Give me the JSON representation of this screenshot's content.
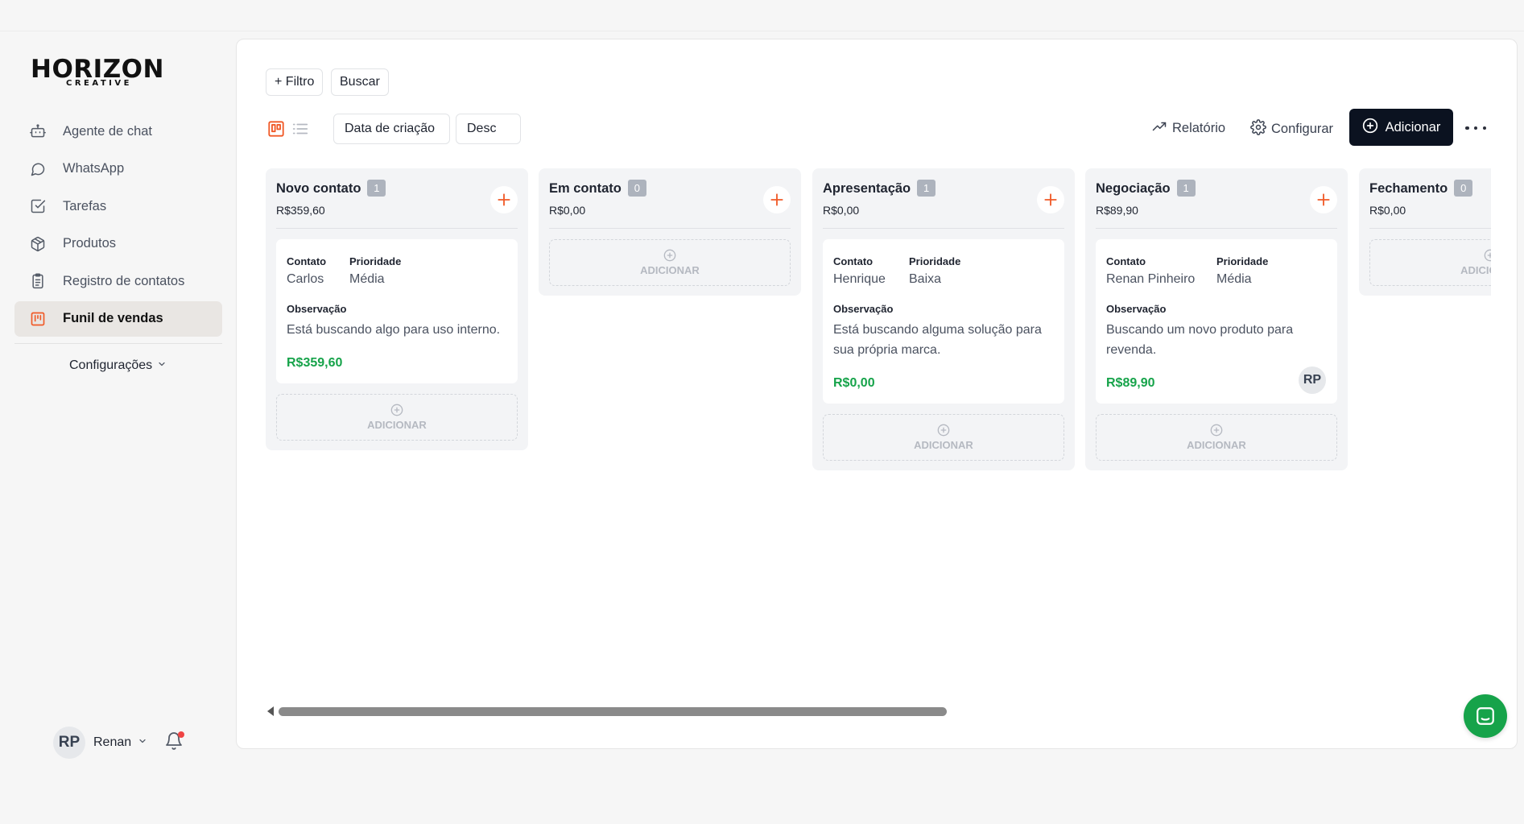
{
  "brand": {
    "name": "HORIZON",
    "tagline": "CREATIVE"
  },
  "sidebar": {
    "items": [
      {
        "label": "Agente de chat",
        "icon": "bot-icon"
      },
      {
        "label": "WhatsApp",
        "icon": "chat-bubble-icon"
      },
      {
        "label": "Tarefas",
        "icon": "checkbox-icon"
      },
      {
        "label": "Produtos",
        "icon": "package-icon"
      },
      {
        "label": "Registro de contatos",
        "icon": "clipboard-icon"
      },
      {
        "label": "Funil de vendas",
        "icon": "kanban-icon",
        "active": true
      }
    ],
    "settings_label": "Configurações",
    "user": {
      "initials": "RP",
      "name": "Renan",
      "has_notification": true
    }
  },
  "toolbar": {
    "filter_label": "+ Filtro",
    "search_label": "Buscar",
    "sort_field": "Data de criação",
    "sort_order": "Desc",
    "report_label": "Relatório",
    "configure_label": "Configurar",
    "add_label": "Adicionar"
  },
  "board": {
    "add_slot_label": "ADICIONAR",
    "field_labels": {
      "contact": "Contato",
      "priority": "Prioridade",
      "observation": "Observação"
    },
    "columns": [
      {
        "title": "Novo contato",
        "count": "1",
        "total": "R$359,60",
        "cards": [
          {
            "contact": "Carlos",
            "priority": "Média",
            "observation": "Está buscando algo para uso interno.",
            "value": "R$359,60",
            "avatar": ""
          }
        ]
      },
      {
        "title": "Em contato",
        "count": "0",
        "total": "R$0,00",
        "cards": []
      },
      {
        "title": "Apresentação",
        "count": "1",
        "total": "R$0,00",
        "cards": [
          {
            "contact": "Henrique",
            "priority": "Baixa",
            "observation": "Está buscando alguma solução para sua própria marca.",
            "value": "R$0,00",
            "avatar": ""
          }
        ]
      },
      {
        "title": "Negociação",
        "count": "1",
        "total": "R$89,90",
        "cards": [
          {
            "contact": "Renan Pinheiro",
            "priority": "Média",
            "observation": "Buscando um novo produto para revenda.",
            "value": "R$89,90",
            "avatar": "RP"
          }
        ]
      },
      {
        "title": "Fechamento",
        "count": "0",
        "total": "R$0,00",
        "cards": []
      }
    ]
  },
  "colors": {
    "accent": "#f05a28",
    "primary": "#0b1220",
    "success": "#16a34a",
    "active_nav": "#e9e6e3"
  }
}
